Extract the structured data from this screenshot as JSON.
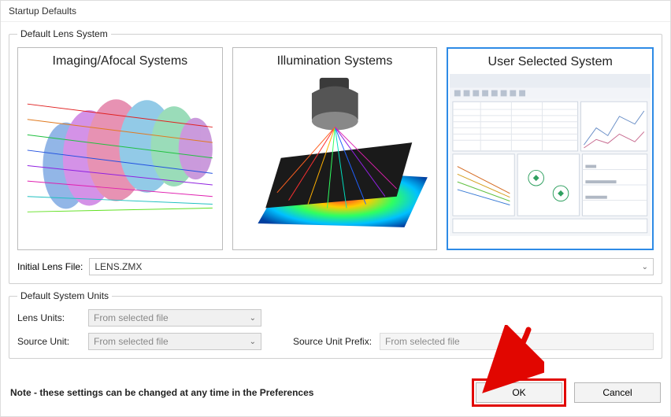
{
  "window": {
    "title": "Startup Defaults"
  },
  "lensGroup": {
    "legend": "Default Lens System",
    "cards": [
      {
        "title": "Imaging/Afocal Systems"
      },
      {
        "title": "Illumination Systems"
      },
      {
        "title": "User Selected System"
      }
    ],
    "initialLensLabel": "Initial Lens File:",
    "initialLensValue": "LENS.ZMX"
  },
  "unitsGroup": {
    "legend": "Default System Units",
    "lensUnitsLabel": "Lens Units:",
    "lensUnitsValue": "From selected file",
    "sourceUnitLabel": "Source Unit:",
    "sourceUnitValue": "From selected file",
    "sourceUnitPrefixLabel": "Source Unit Prefix:",
    "sourceUnitPrefixValue": "From selected file"
  },
  "footer": {
    "note": "Note - these settings can be changed at any time in the Preferences",
    "okLabel": "OK",
    "cancelLabel": "Cancel"
  }
}
